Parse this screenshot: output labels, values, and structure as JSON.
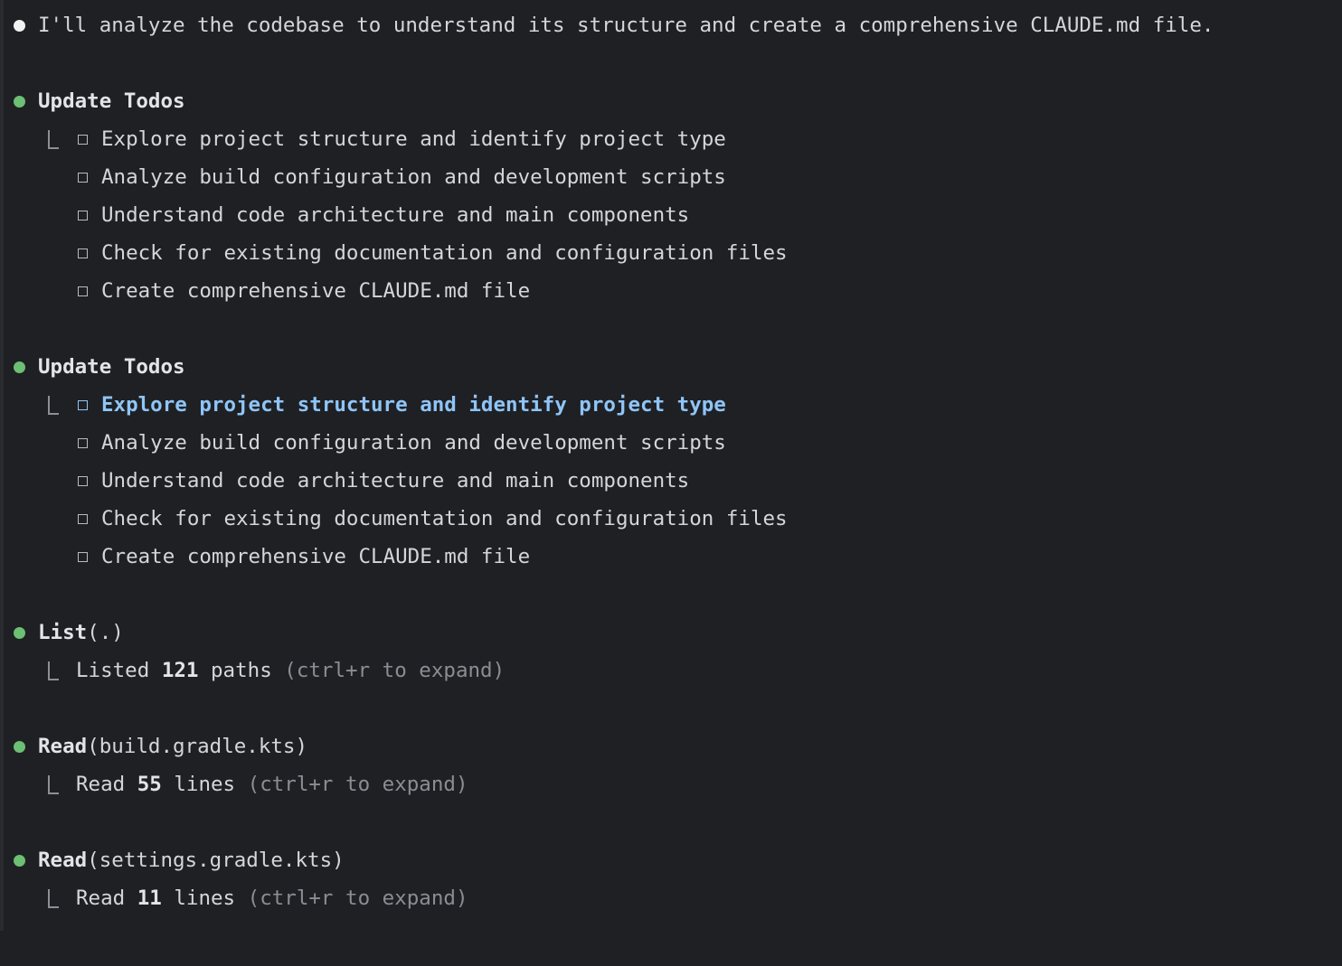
{
  "intro": {
    "text": "I'll analyze the codebase to understand its structure and create a comprehensive CLAUDE.md file."
  },
  "todos_block_1": {
    "title": "Update Todos",
    "items": [
      "Explore project structure and identify project type",
      "Analyze build configuration and development scripts",
      "Understand code architecture and main components",
      "Check for existing documentation and configuration files",
      "Create comprehensive CLAUDE.md file"
    ]
  },
  "todos_block_2": {
    "title": "Update Todos",
    "active_index": 0,
    "items": [
      "Explore project structure and identify project type",
      "Analyze build configuration and development scripts",
      "Understand code architecture and main components",
      "Check for existing documentation and configuration files",
      "Create comprehensive CLAUDE.md file"
    ]
  },
  "tool_list": {
    "name": "List",
    "arg": "(.)",
    "result_prefix": "Listed ",
    "result_count": "121",
    "result_suffix": " paths ",
    "hint": "(ctrl+r to expand)"
  },
  "tool_read_1": {
    "name": "Read",
    "arg": "(build.gradle.kts)",
    "result_prefix": "Read ",
    "result_count": "55",
    "result_suffix": " lines ",
    "hint": "(ctrl+r to expand)"
  },
  "tool_read_2": {
    "name": "Read",
    "arg": "(settings.gradle.kts)",
    "result_prefix": "Read ",
    "result_count": "11",
    "result_suffix": " lines ",
    "hint": "(ctrl+r to expand)"
  },
  "colors": {
    "background": "#1f2023",
    "text": "#d4d6da",
    "bullet_green": "#6cbf73",
    "highlight_blue": "#8fc5f8",
    "dim": "#8a8d93"
  }
}
